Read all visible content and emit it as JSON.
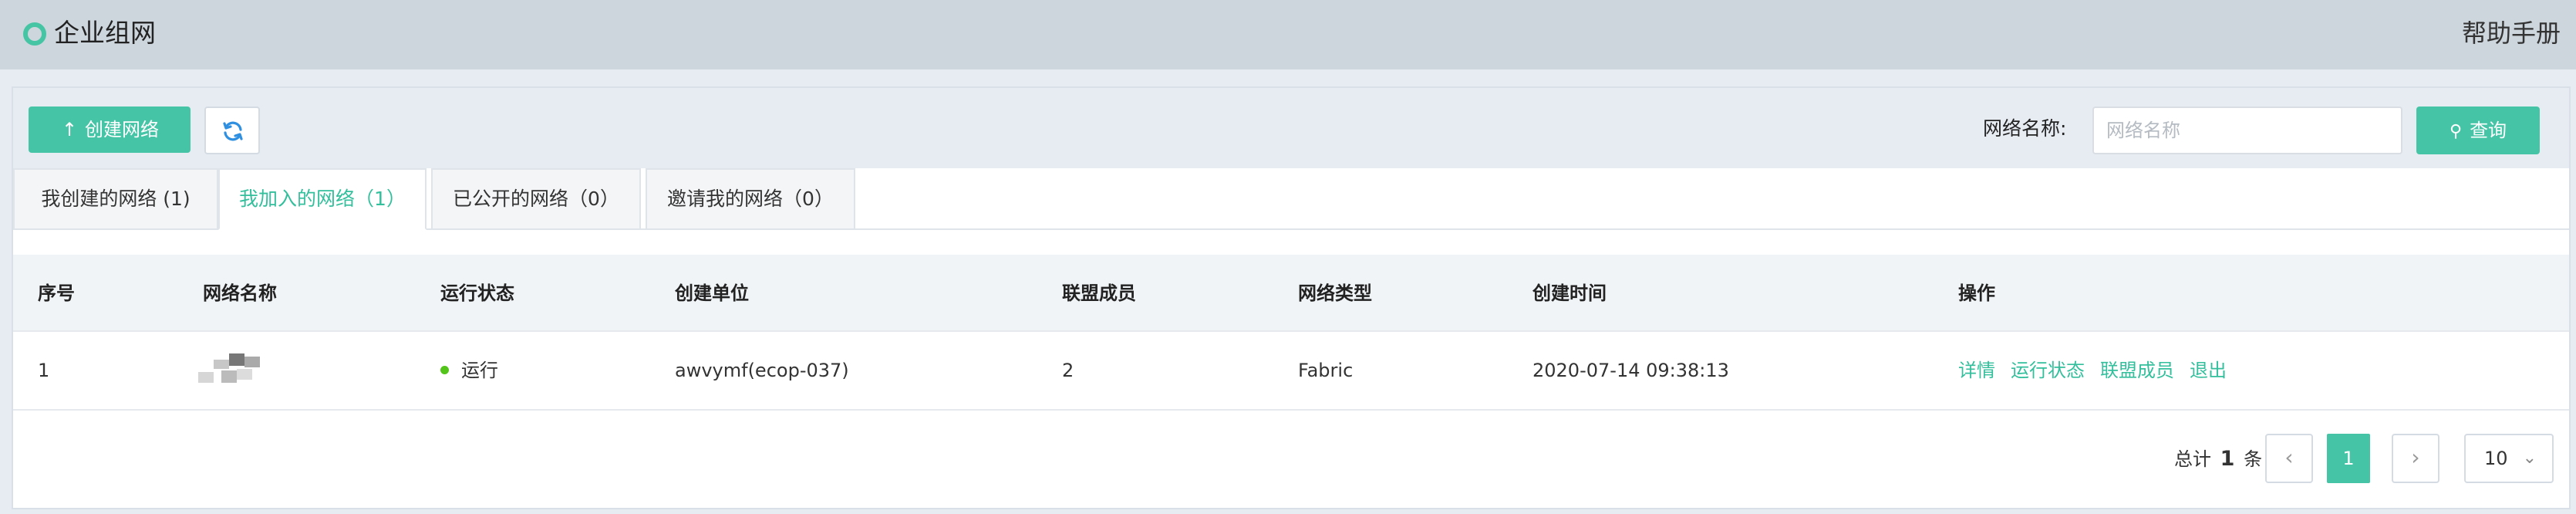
{
  "header": {
    "app_title": "企业组网",
    "help_label": "帮助手册",
    "logo_icon": "ring-logo-icon",
    "accent_color": "#45c5a5"
  },
  "toolbar": {
    "create_label": "创建网络",
    "create_icon": "arrow-up-icon",
    "refresh_icon": "refresh-icon",
    "name_label": "网络名称:",
    "name_placeholder": "网络名称",
    "name_value": "",
    "query_label": "查询",
    "query_icon": "search-icon"
  },
  "tabs": [
    {
      "label": "我创建的网络 (1)",
      "active": false
    },
    {
      "label": "我加入的网络（1）",
      "active": true
    },
    {
      "label": "已公开的网络（0）",
      "active": false
    },
    {
      "label": "邀请我的网络（0）",
      "active": false
    }
  ],
  "table": {
    "columns": [
      "序号",
      "网络名称",
      "运行状态",
      "创建单位",
      "联盟成员",
      "网络类型",
      "创建时间",
      "操作"
    ],
    "rows": [
      {
        "index": "1",
        "name": "",
        "status": "运行",
        "status_color": "#52c41a",
        "creator": "awvymf(ecop-037)",
        "members": "2",
        "type": "Fabric",
        "created_at": "2020-07-14 09:38:13",
        "actions": [
          "详情",
          "运行状态",
          "联盟成员",
          "退出"
        ]
      }
    ]
  },
  "pagination": {
    "total_prefix": "总计",
    "total_count": "1",
    "total_suffix": "条",
    "prev_icon": "chevron-left-icon",
    "next_icon": "chevron-right-icon",
    "current_page": "1",
    "page_size": "10"
  }
}
